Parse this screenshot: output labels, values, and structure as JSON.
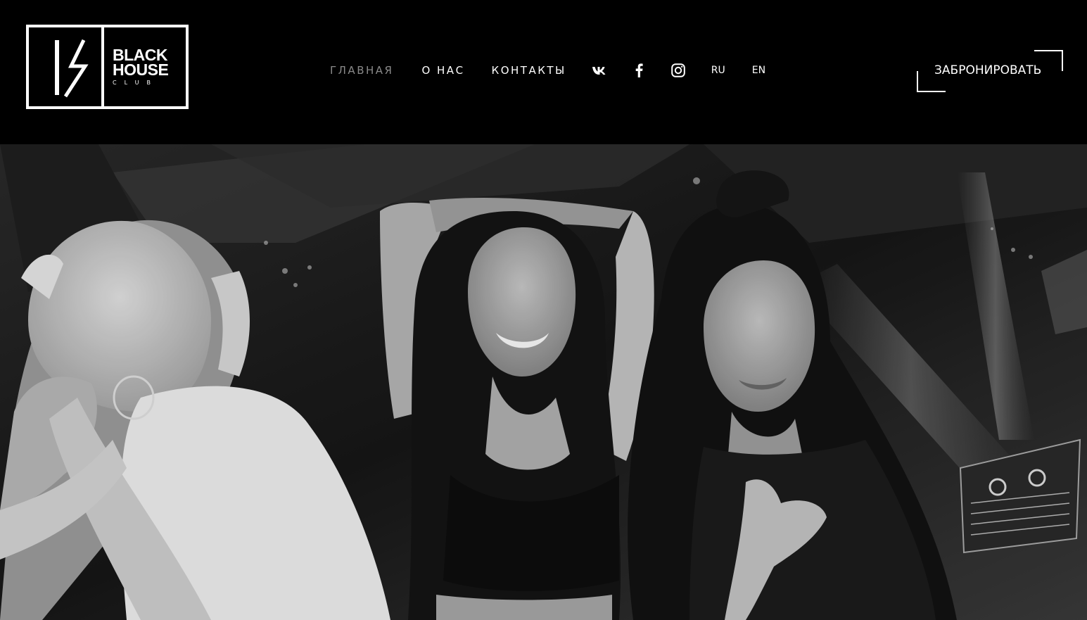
{
  "brand": {
    "logo_line1": "BLACK",
    "logo_line2": "HOUSE",
    "logo_line3": "CLUB"
  },
  "nav": {
    "items": [
      {
        "label": "ГЛАВНАЯ",
        "active": true
      },
      {
        "label": "О НАС",
        "active": false
      },
      {
        "label": "КОНТАКТЫ",
        "active": false
      }
    ],
    "social": [
      "vk-icon",
      "facebook-icon",
      "instagram-icon"
    ],
    "languages": [
      "RU",
      "EN"
    ]
  },
  "cta": {
    "label": "ЗАБРОНИРОВАТЬ"
  },
  "colors": {
    "background": "#000000",
    "text": "#ffffff",
    "nav_active": "#8a8a8a"
  },
  "hero": {
    "description_icon": "hero-photo"
  }
}
